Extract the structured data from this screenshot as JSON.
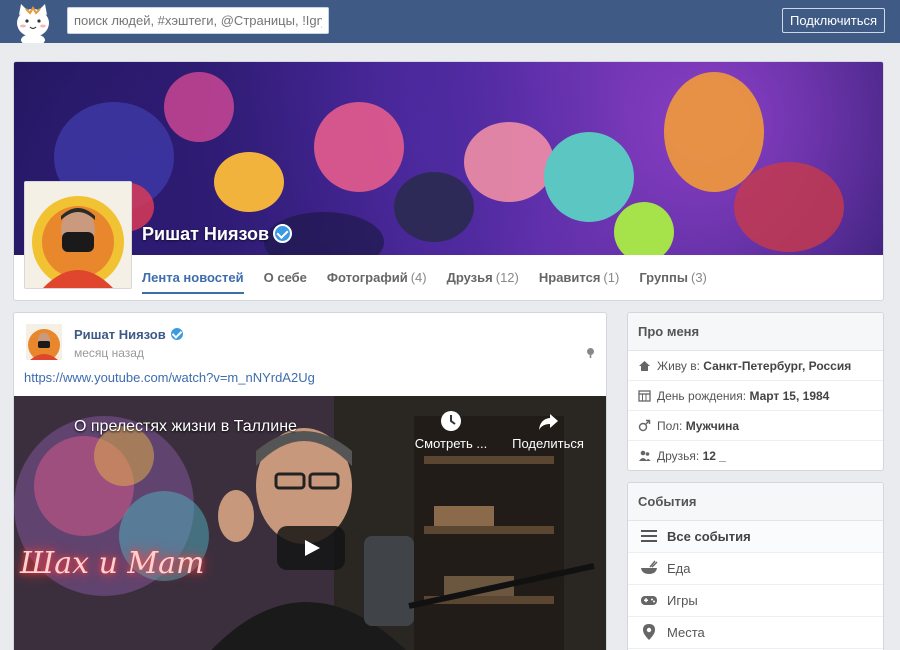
{
  "topbar": {
    "search_placeholder": "поиск людей, #хэштеги, @Страницы, !Igry",
    "connect_label": "Подключиться"
  },
  "profile": {
    "name": "Ришат Ниязов",
    "tabs": [
      {
        "label": "Лента новостей",
        "count": ""
      },
      {
        "label": "О себе",
        "count": ""
      },
      {
        "label": "Фотографий",
        "count": "(4)"
      },
      {
        "label": "Друзья",
        "count": "(12)"
      },
      {
        "label": "Нравится",
        "count": "(1)"
      },
      {
        "label": "Группы",
        "count": "(3)"
      }
    ]
  },
  "post": {
    "author": "Ришат Ниязов",
    "time": "месяц назад",
    "link": "https://www.youtube.com/watch?v=m_nNYrdA2Ug",
    "video": {
      "title": "О прелестях жизни в Таллине",
      "watch_later": "Смотреть ...",
      "share": "Поделиться",
      "neon_text": "Шах и Мат"
    }
  },
  "about": {
    "title": "Про меня",
    "rows": [
      {
        "label": "Живу в:",
        "value": "Санкт-Петербург, Россия",
        "icon": "home-icon"
      },
      {
        "label": "День рождения:",
        "value": "Март 15, 1984",
        "icon": "calendar-icon"
      },
      {
        "label": "Пол:",
        "value": "Мужчина",
        "icon": "gender-icon"
      },
      {
        "label": "Друзья:",
        "value": "12 _",
        "icon": "friends-icon"
      }
    ]
  },
  "events": {
    "title": "События",
    "items": [
      {
        "label": "Все события",
        "icon": "menu-icon"
      },
      {
        "label": "Еда",
        "icon": "food-bowl-icon"
      },
      {
        "label": "Игры",
        "icon": "gamepad-icon"
      },
      {
        "label": "Места",
        "icon": "location-pin-icon"
      }
    ]
  },
  "colors": {
    "topbar": "#3f5b85",
    "link": "#3d6dad",
    "background": "#e9ebee",
    "verified": "#3b9ae1"
  }
}
